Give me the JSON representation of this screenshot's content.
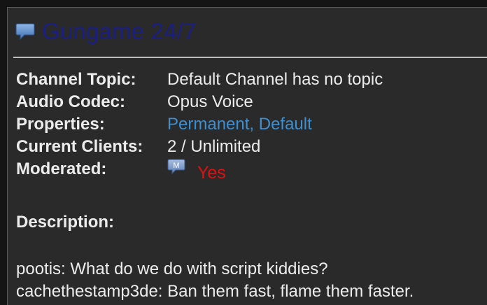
{
  "channel": {
    "name": "Gungame 24/7",
    "icon": "speech-bubble-icon",
    "title_color": "#1b1f7f"
  },
  "info": {
    "topic": {
      "label": "Channel Topic:",
      "value": "Default Channel has no topic"
    },
    "codec": {
      "label": "Audio Codec:",
      "value": "Opus Voice"
    },
    "properties": {
      "label": "Properties:",
      "value": "Permanent, Default",
      "color": "#3d8fd1"
    },
    "clients": {
      "label": "Current Clients:",
      "value": "2 / Unlimited"
    },
    "moderated": {
      "label": "Moderated:",
      "icon": "moderated-m-icon",
      "icon_letter": "M",
      "value": "Yes",
      "color": "#e01010"
    }
  },
  "description": {
    "label": "Description:",
    "lines": [
      "pootis: What do we do with script kiddies?",
      "cachethestamp3de: Ban them fast, flame them faster."
    ]
  }
}
